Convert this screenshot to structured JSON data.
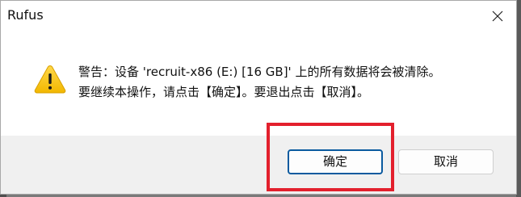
{
  "window": {
    "title": "Rufus",
    "close_icon": "close-icon"
  },
  "message": {
    "icon": "warning-icon",
    "line1": "警告：设备 'recruit-x86 (E:) [16 GB]' 上的所有数据将会被清除。",
    "line2": "要继续本操作，请点击【确定】。要退出点击【取消】。"
  },
  "buttons": {
    "ok_label": "确定",
    "cancel_label": "取消"
  },
  "colors": {
    "highlight": "#e3202d",
    "warning": "#f5c400",
    "accent": "#0a5a9f"
  }
}
